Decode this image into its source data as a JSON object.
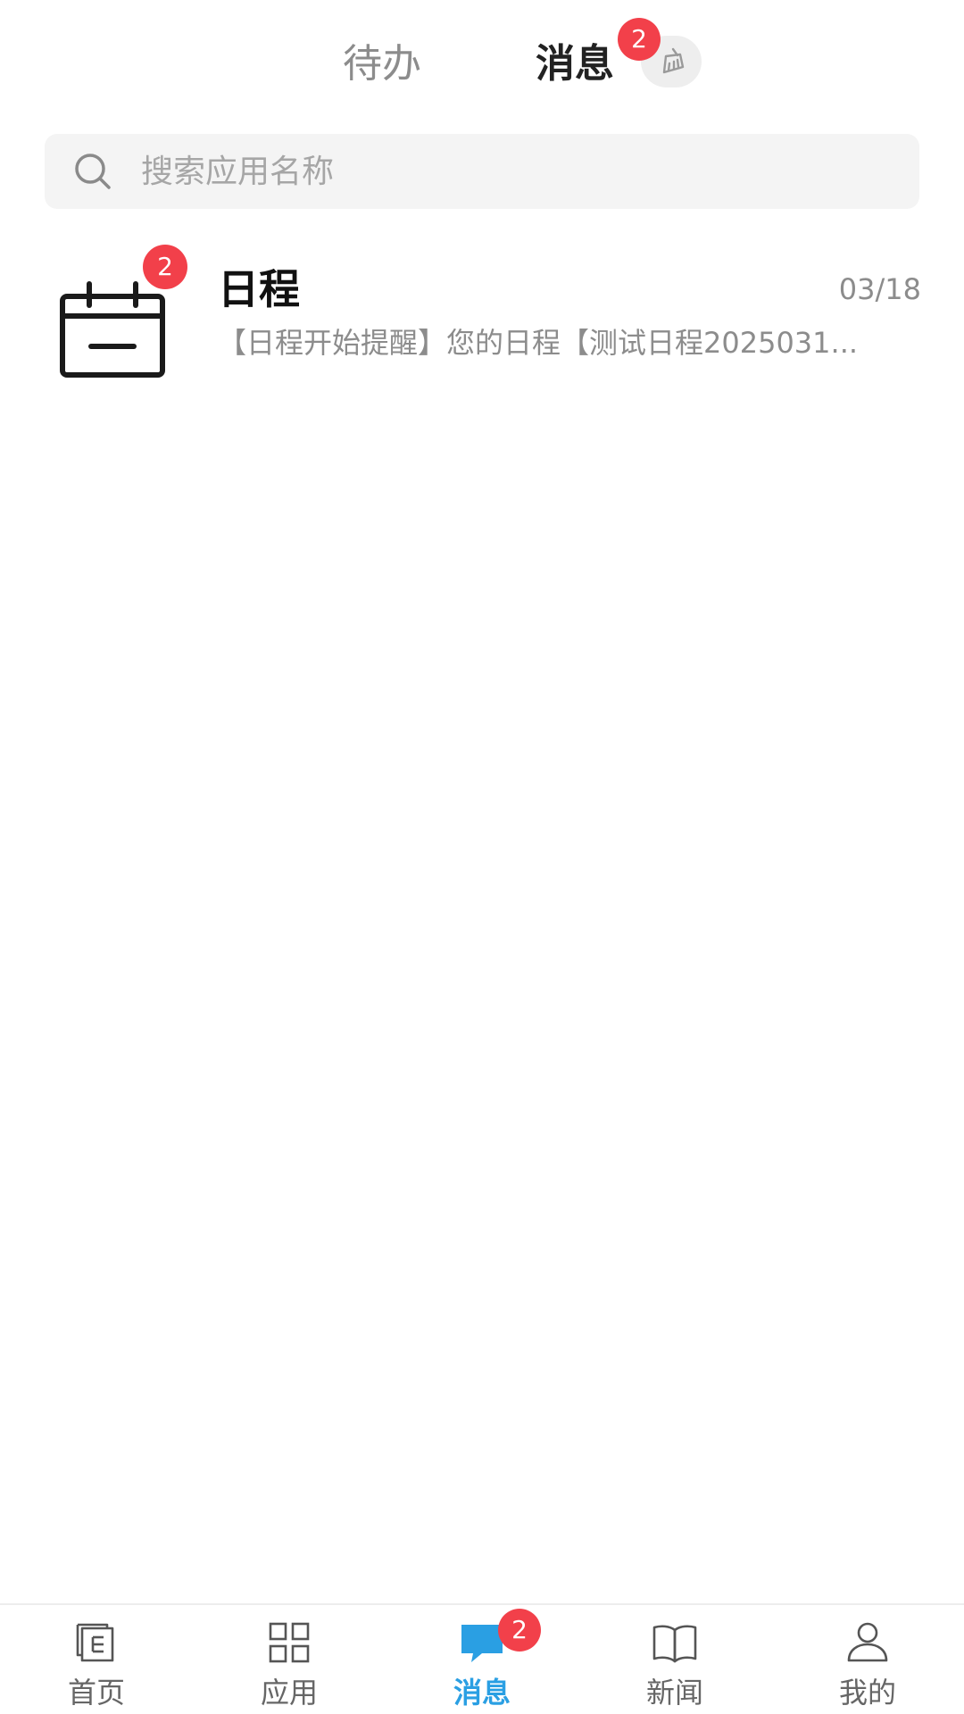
{
  "top_tabs": {
    "todo_label": "待办",
    "messages_label": "消息",
    "messages_badge": "2",
    "active": "messages"
  },
  "search": {
    "placeholder": "搜索应用名称",
    "value": ""
  },
  "messages": [
    {
      "icon": "calendar-icon",
      "title": "日程",
      "badge": "2",
      "time": "03/18",
      "preview": "【日程开始提醒】您的日程【测试日程2025031..."
    }
  ],
  "bottom_nav": {
    "items": [
      {
        "label": "首页",
        "icon": "home-icon"
      },
      {
        "label": "应用",
        "icon": "apps-grid-icon"
      },
      {
        "label": "消息",
        "icon": "chat-bubble-icon",
        "badge": "2",
        "active": true
      },
      {
        "label": "新闻",
        "icon": "book-icon"
      },
      {
        "label": "我的",
        "icon": "person-icon"
      }
    ]
  },
  "colors": {
    "accent": "#2a9fe3",
    "badge": "#f2404a",
    "text_primary": "#111111",
    "text_secondary": "#8c8c8c",
    "search_bg": "#f4f4f4"
  }
}
